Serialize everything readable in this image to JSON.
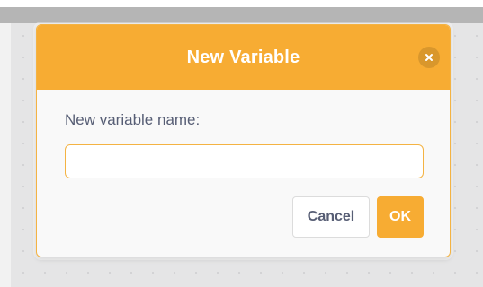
{
  "dialog": {
    "title": "New Variable",
    "close_icon": "close-icon",
    "field_label": "New variable name:",
    "input_value": "",
    "input_placeholder": "",
    "cancel_label": "Cancel",
    "ok_label": "OK"
  },
  "colors": {
    "header": "#f7ac33",
    "accent_border": "#f4b343",
    "label_text": "#575e75",
    "dialog_background": "#f9f9f9",
    "workspace_background": "#e5e5e6"
  }
}
